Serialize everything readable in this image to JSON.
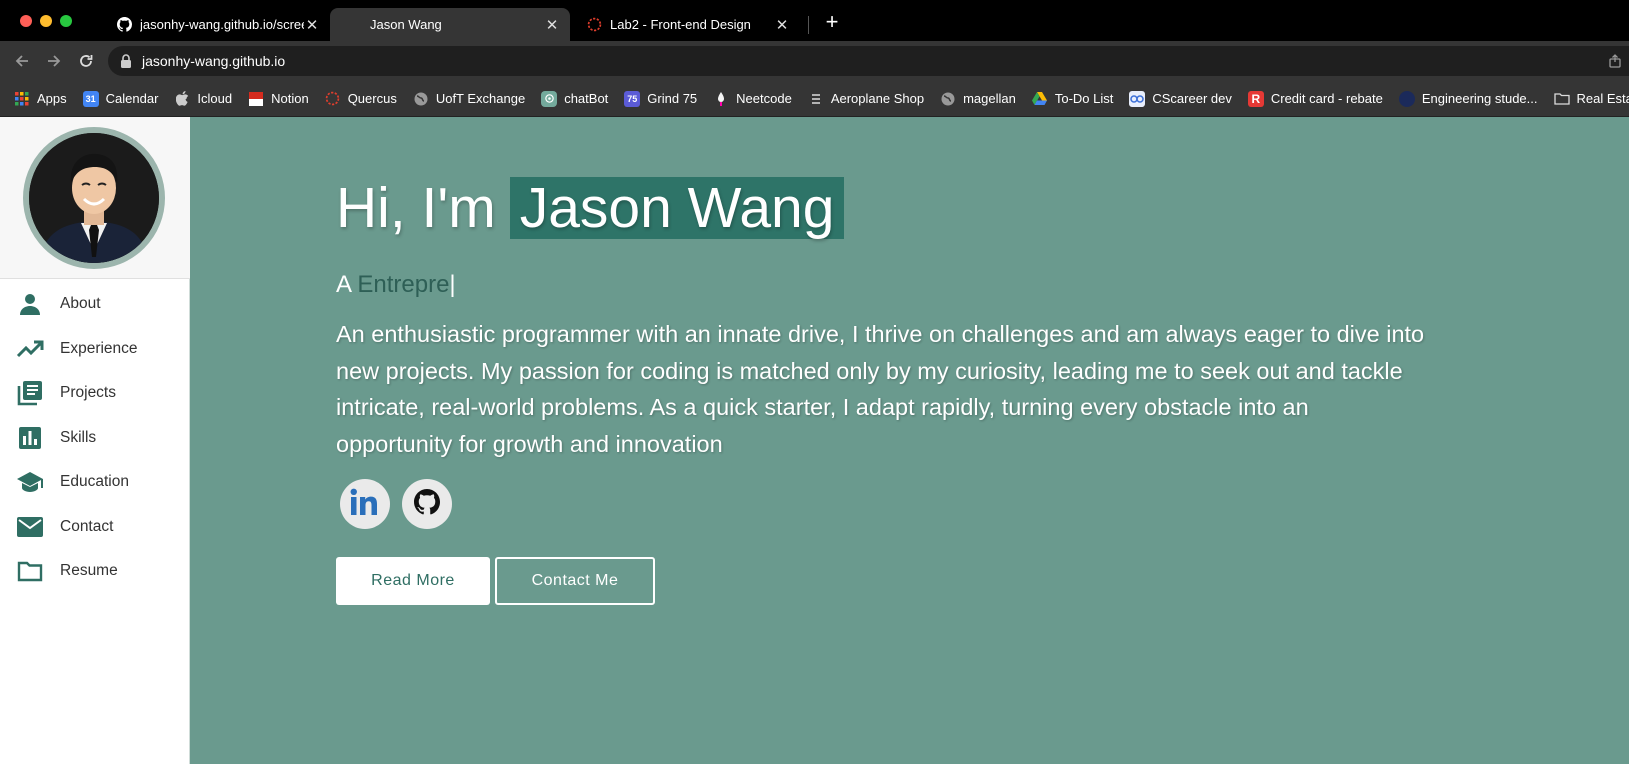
{
  "tabs": [
    {
      "title": "jasonhy-wang.github.io/screens",
      "icon": "github-icon"
    },
    {
      "title": "Jason Wang",
      "icon": "blank-icon"
    },
    {
      "title": "Lab2 - Front-end Design",
      "icon": "quercus-icon"
    }
  ],
  "toolbar": {
    "url": "jasonhy-wang.github.io"
  },
  "bookmarks": [
    {
      "label": "Apps",
      "icon": "apps-grid-icon"
    },
    {
      "label": "Calendar",
      "icon": "calendar-icon"
    },
    {
      "label": "Icloud",
      "icon": "apple-icon"
    },
    {
      "label": "Notion",
      "icon": "notion-icon"
    },
    {
      "label": "Quercus",
      "icon": "quercus-icon"
    },
    {
      "label": "UofT Exchange",
      "icon": "globe-icon"
    },
    {
      "label": "chatBot",
      "icon": "openai-icon"
    },
    {
      "label": "Grind 75",
      "icon": "grind75-icon"
    },
    {
      "label": "Neetcode",
      "icon": "neetcode-icon"
    },
    {
      "label": "Aeroplane Shop",
      "icon": "list-icon"
    },
    {
      "label": "magellan",
      "icon": "globe-icon"
    },
    {
      "label": "To-Do List",
      "icon": "drive-icon"
    },
    {
      "label": "CScareer dev",
      "icon": "cscareer-icon"
    },
    {
      "label": "Credit card - rebate",
      "icon": "r-icon"
    },
    {
      "label": "Engineering stude...",
      "icon": "engineering-icon"
    },
    {
      "label": "Real Esta",
      "icon": "folder-icon"
    }
  ],
  "sidebar": {
    "items": [
      {
        "label": "About",
        "icon": "person-icon"
      },
      {
        "label": "Experience",
        "icon": "trending-up-icon"
      },
      {
        "label": "Projects",
        "icon": "library-books-icon"
      },
      {
        "label": "Skills",
        "icon": "bar-chart-icon"
      },
      {
        "label": "Education",
        "icon": "school-icon"
      },
      {
        "label": "Contact",
        "icon": "mail-icon"
      },
      {
        "label": "Resume",
        "icon": "folder-icon"
      }
    ]
  },
  "hero": {
    "greeting": "Hi, I'm",
    "name": "Jason Wang",
    "typed_prefix": "A",
    "typed_word": "Entrepre",
    "typed_cursor": "|",
    "bio": "An enthusiastic programmer with an innate drive, I thrive on challenges and am always eager to dive into new projects. My passion for coding is matched only by my curiosity, leading me to seek out and tackle intricate, real-world problems. As a quick starter, I adapt rapidly, turning every obstacle into an opportunity for growth and innovation",
    "read_more_label": "Read More",
    "contact_label": "Contact Me"
  },
  "colors": {
    "accent": "#2e7468",
    "page_bg": "#6a9a8e",
    "sidebar_icon": "#2f6e63"
  }
}
